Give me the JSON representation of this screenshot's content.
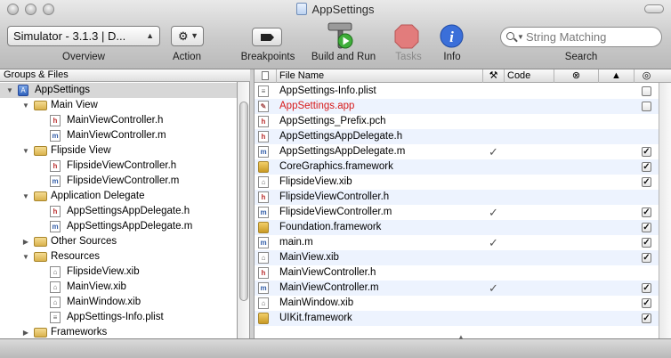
{
  "window": {
    "title": "AppSettings"
  },
  "toolbar": {
    "overview_popup": "Simulator - 3.1.3 | D...",
    "overview_label": "Overview",
    "action_label": "Action",
    "breakpoints_label": "Breakpoints",
    "build_run_label": "Build and Run",
    "tasks_label": "Tasks",
    "info_label": "Info",
    "search_placeholder": "String Matching",
    "search_label": "Search"
  },
  "sidebar": {
    "header": "Groups & Files",
    "tree": [
      {
        "label": "AppSettings",
        "kind": "project",
        "indent": 0,
        "open": true,
        "selected": true
      },
      {
        "label": "Main View",
        "kind": "folder",
        "indent": 1,
        "open": true
      },
      {
        "label": "MainViewController.h",
        "kind": "h",
        "indent": 2
      },
      {
        "label": "MainViewController.m",
        "kind": "m",
        "indent": 2
      },
      {
        "label": "Flipside View",
        "kind": "folder",
        "indent": 1,
        "open": true
      },
      {
        "label": "FlipsideViewController.h",
        "kind": "h",
        "indent": 2
      },
      {
        "label": "FlipsideViewController.m",
        "kind": "m",
        "indent": 2
      },
      {
        "label": "Application Delegate",
        "kind": "folder",
        "indent": 1,
        "open": true
      },
      {
        "label": "AppSettingsAppDelegate.h",
        "kind": "h",
        "indent": 2
      },
      {
        "label": "AppSettingsAppDelegate.m",
        "kind": "m",
        "indent": 2
      },
      {
        "label": "Other Sources",
        "kind": "folder",
        "indent": 1,
        "open": false
      },
      {
        "label": "Resources",
        "kind": "folder",
        "indent": 1,
        "open": true
      },
      {
        "label": "FlipsideView.xib",
        "kind": "xib",
        "indent": 2
      },
      {
        "label": "MainView.xib",
        "kind": "xib",
        "indent": 2
      },
      {
        "label": "MainWindow.xib",
        "kind": "xib",
        "indent": 2
      },
      {
        "label": "AppSettings-Info.plist",
        "kind": "plist",
        "indent": 2
      },
      {
        "label": "Frameworks",
        "kind": "folder",
        "indent": 1,
        "open": false
      }
    ]
  },
  "file_table": {
    "columns": {
      "name": "File Name",
      "code": "Code"
    },
    "rows": [
      {
        "name": "AppSettings-Info.plist",
        "kind": "plist",
        "built": false,
        "target": false
      },
      {
        "name": "AppSettings.app",
        "kind": "app",
        "built": false,
        "target": false,
        "missing": true
      },
      {
        "name": "AppSettings_Prefix.pch",
        "kind": "h",
        "built": false,
        "target": null
      },
      {
        "name": "AppSettingsAppDelegate.h",
        "kind": "h",
        "built": false,
        "target": null
      },
      {
        "name": "AppSettingsAppDelegate.m",
        "kind": "m",
        "built": true,
        "target": true
      },
      {
        "name": "CoreGraphics.framework",
        "kind": "framework",
        "built": false,
        "target": true
      },
      {
        "name": "FlipsideView.xib",
        "kind": "xib",
        "built": false,
        "target": true
      },
      {
        "name": "FlipsideViewController.h",
        "kind": "h",
        "built": false,
        "target": null
      },
      {
        "name": "FlipsideViewController.m",
        "kind": "m",
        "built": true,
        "target": true
      },
      {
        "name": "Foundation.framework",
        "kind": "framework",
        "built": false,
        "target": true
      },
      {
        "name": "main.m",
        "kind": "m",
        "built": true,
        "target": true
      },
      {
        "name": "MainView.xib",
        "kind": "xib",
        "built": false,
        "target": true
      },
      {
        "name": "MainViewController.h",
        "kind": "h",
        "built": false,
        "target": null
      },
      {
        "name": "MainViewController.m",
        "kind": "m",
        "built": true,
        "target": true
      },
      {
        "name": "MainWindow.xib",
        "kind": "xib",
        "built": false,
        "target": true
      },
      {
        "name": "UIKit.framework",
        "kind": "framework",
        "built": false,
        "target": true
      }
    ]
  },
  "colors": {
    "missing_file": "#d71a1a",
    "row_stripe": "#edf3fe",
    "selection": "#d7d7d7"
  }
}
